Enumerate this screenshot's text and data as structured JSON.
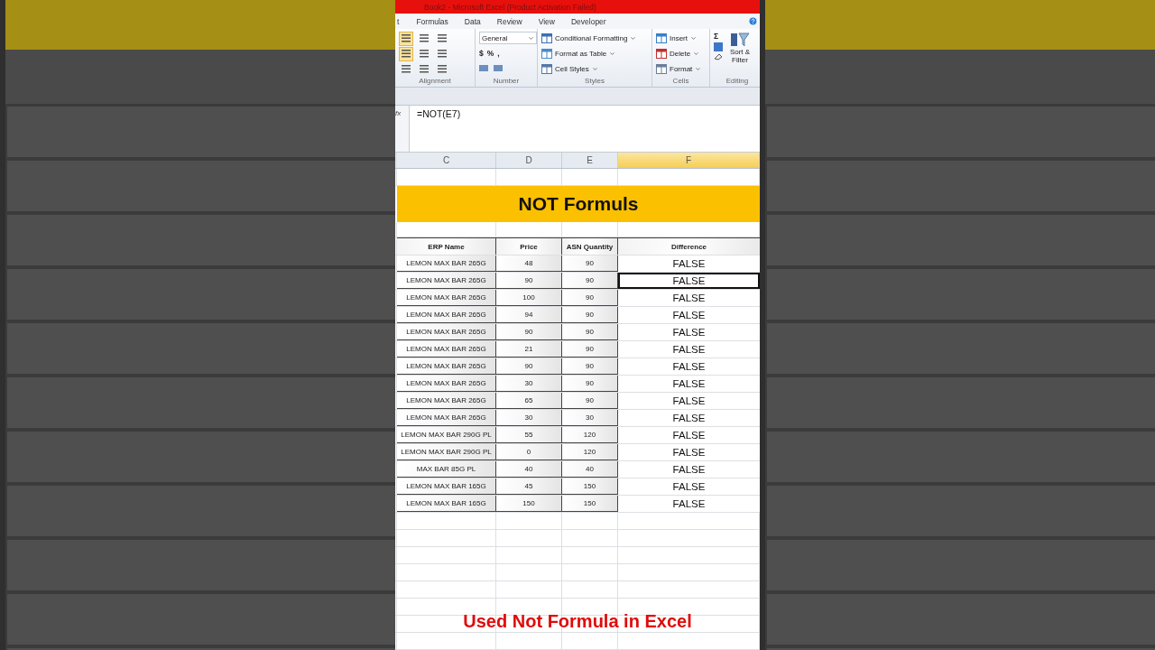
{
  "window": {
    "title": "Book2 - Microsoft Excel (Product Activation Failed)"
  },
  "tabs": [
    {
      "label": "t",
      "selected": false
    },
    {
      "label": "Formulas",
      "selected": false
    },
    {
      "label": "Data",
      "selected": false
    },
    {
      "label": "Review",
      "selected": false
    },
    {
      "label": "View",
      "selected": false
    },
    {
      "label": "Developer",
      "selected": false
    }
  ],
  "ribbon": {
    "alignment": {
      "label": "Alignment",
      "buttons": [
        [
          {
            "selected": true
          },
          {
            "selected": false
          },
          {
            "selected": false
          }
        ],
        [
          {
            "selected": true
          },
          {
            "selected": false
          },
          {
            "selected": false
          }
        ],
        [
          {
            "selected": false
          },
          {
            "selected": false
          },
          {
            "selected": false
          }
        ]
      ]
    },
    "number": {
      "label": "Number",
      "format": "General",
      "symbols": [
        "$",
        "%",
        ","
      ]
    },
    "styles": {
      "label": "Styles",
      "items": [
        "Conditional Formatting",
        "Format as Table",
        "Cell Styles"
      ]
    },
    "cells": {
      "label": "Cells",
      "items": [
        "Insert",
        "Delete",
        "Format"
      ]
    },
    "editing": {
      "label": "Editing",
      "sum": "Σ",
      "sort": "Sort & Filter"
    }
  },
  "formula_bar": {
    "fx": "fx",
    "value": "=NOT(E7)"
  },
  "columns": [
    {
      "label": "C",
      "selected": false
    },
    {
      "label": "D",
      "selected": false
    },
    {
      "label": "E",
      "selected": false
    },
    {
      "label": "F",
      "selected": true
    }
  ],
  "banner": "NOT Formuls",
  "table": {
    "columns": [
      "ERP Name",
      "Price",
      "ASN Quantity",
      "Difference"
    ],
    "rows": [
      {
        "name": "LEMON MAX BAR 265G",
        "price": "48",
        "qty": "90",
        "difference": "FALSE",
        "selected": false
      },
      {
        "name": "LEMON MAX BAR 265G",
        "price": "90",
        "qty": "90",
        "difference": "FALSE",
        "selected": true
      },
      {
        "name": "LEMON MAX BAR 265G",
        "price": "100",
        "qty": "90",
        "difference": "FALSE",
        "selected": false
      },
      {
        "name": "LEMON MAX BAR 265G",
        "price": "94",
        "qty": "90",
        "difference": "FALSE",
        "selected": false
      },
      {
        "name": "LEMON MAX BAR 265G",
        "price": "90",
        "qty": "90",
        "difference": "FALSE",
        "selected": false
      },
      {
        "name": "LEMON MAX BAR 265G",
        "price": "21",
        "qty": "90",
        "difference": "FALSE",
        "selected": false
      },
      {
        "name": "LEMON MAX BAR 265G",
        "price": "90",
        "qty": "90",
        "difference": "FALSE",
        "selected": false
      },
      {
        "name": "LEMON MAX BAR 265G",
        "price": "30",
        "qty": "90",
        "difference": "FALSE",
        "selected": false
      },
      {
        "name": "LEMON MAX BAR 265G",
        "price": "65",
        "qty": "90",
        "difference": "FALSE",
        "selected": false
      },
      {
        "name": "LEMON MAX BAR 265G",
        "price": "30",
        "qty": "30",
        "difference": "FALSE",
        "selected": false
      },
      {
        "name": "LEMON MAX BAR 290G PL",
        "price": "55",
        "qty": "120",
        "difference": "FALSE",
        "selected": false
      },
      {
        "name": "LEMON MAX BAR 290G PL",
        "price": "0",
        "qty": "120",
        "difference": "FALSE",
        "selected": false
      },
      {
        "name": "MAX BAR 85G PL",
        "price": "40",
        "qty": "40",
        "difference": "FALSE",
        "selected": false
      },
      {
        "name": "LEMON MAX BAR 165G",
        "price": "45",
        "qty": "150",
        "difference": "FALSE",
        "selected": false
      },
      {
        "name": "LEMON MAX BAR 165G",
        "price": "150",
        "qty": "150",
        "difference": "FALSE",
        "selected": false
      }
    ]
  },
  "caption": "Used Not Formula in Excel"
}
